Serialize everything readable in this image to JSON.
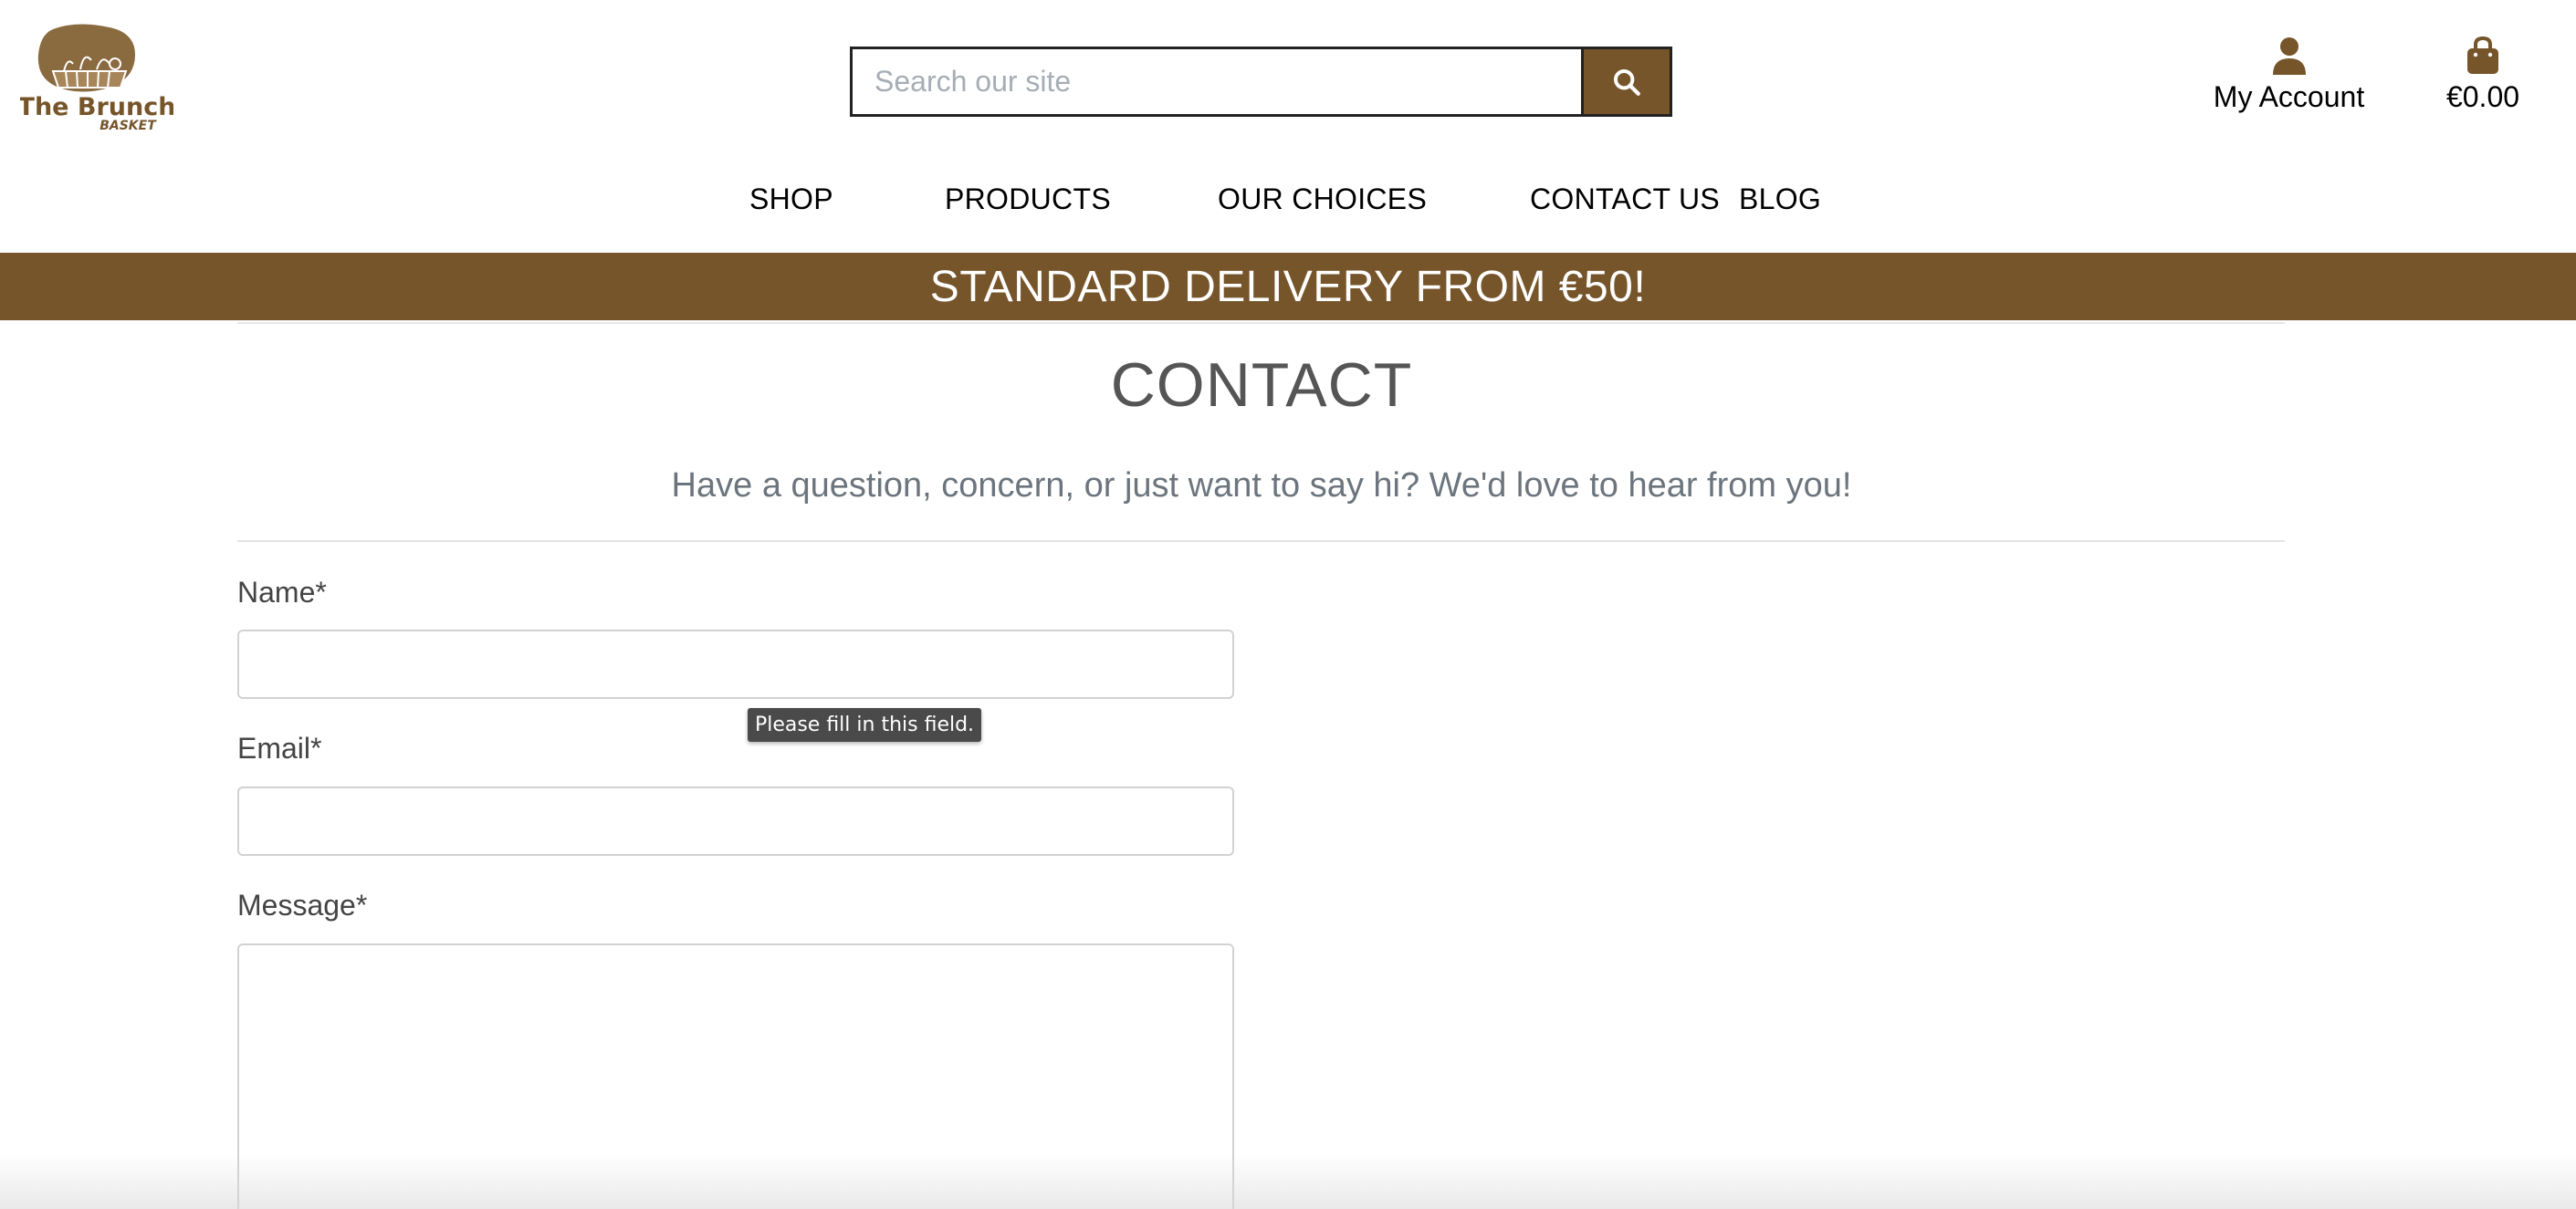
{
  "header": {
    "logo": {
      "name": "The Brunch",
      "sub": "BASKET",
      "brand_color": "#76552b"
    },
    "search": {
      "placeholder": "Search our site",
      "icon": "search-icon"
    },
    "account": {
      "label": "My Account",
      "icon": "user-icon"
    },
    "bag": {
      "total": "€0.00",
      "icon": "shopping-bag-icon"
    }
  },
  "nav": {
    "items": [
      {
        "label": "SHOP"
      },
      {
        "label": "PRODUCTS"
      },
      {
        "label": "OUR CHOICES"
      },
      {
        "label": "CONTACT US"
      },
      {
        "label": "BLOG"
      }
    ]
  },
  "banner": {
    "text": "STANDARD DELIVERY FROM €50!",
    "color": "#76552b"
  },
  "contact": {
    "title": "CONTACT",
    "subtitle": "Have a question, concern, or just want to say hi? We'd love to hear from you!",
    "fields": {
      "name": {
        "label": "Name*",
        "value": ""
      },
      "email": {
        "label": "Email*",
        "value": ""
      },
      "message": {
        "label": "Message*",
        "value": ""
      }
    },
    "validation_tooltip": "Please fill in this field."
  }
}
